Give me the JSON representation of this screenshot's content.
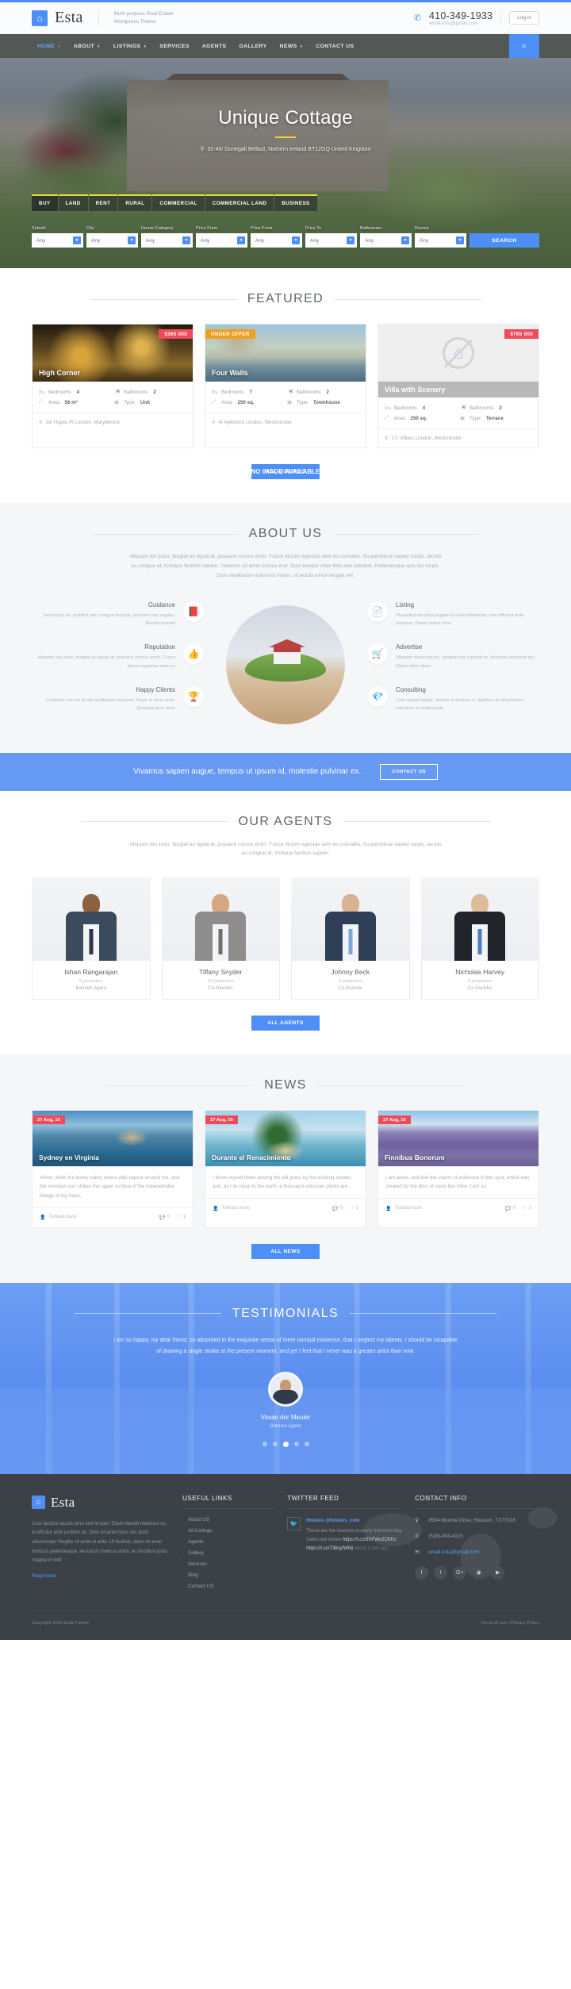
{
  "header": {
    "brand": {
      "name": "Esta",
      "tagline": "Multi-purpose Real Estate Wordpress Theme",
      "icon": "home-icon"
    },
    "phone": "410-349-1933",
    "email": "email.esta@gmail.com",
    "login_label": "Log in"
  },
  "nav": {
    "items": [
      {
        "label": "HOME",
        "has_caret": true,
        "active": true
      },
      {
        "label": "ABOUT",
        "has_caret": true,
        "active": false
      },
      {
        "label": "LISTINGS",
        "has_caret": true,
        "active": false
      },
      {
        "label": "SERVICES",
        "has_caret": false,
        "active": false
      },
      {
        "label": "AGENTS",
        "has_caret": false,
        "active": false
      },
      {
        "label": "GALLERY",
        "has_caret": false,
        "active": false
      },
      {
        "label": "NEWS",
        "has_caret": true,
        "active": false
      },
      {
        "label": "CONTACT US",
        "has_caret": false,
        "active": false
      }
    ],
    "search_icon": "search-icon"
  },
  "hero": {
    "title": "Unique Cottage",
    "address": "32-40/ Donegall Belfast, Nothern Ireland BT12GQ United Kingdom",
    "tabs": [
      "BUY",
      "LAND",
      "RENT",
      "RURAL",
      "COMMERCIAL",
      "COMMERCIAL LAND",
      "BUSINESS"
    ],
    "active_tab": "BUY",
    "fields": [
      {
        "label": "Suburb",
        "value": "Any"
      },
      {
        "label": "City",
        "value": "Any"
      },
      {
        "label": "House Category",
        "value": "Any"
      },
      {
        "label": "Price From",
        "value": "Any"
      },
      {
        "label": "Price From",
        "value": "Any"
      },
      {
        "label": "Price To",
        "value": "Any"
      },
      {
        "label": "Bathrooms",
        "value": "Any"
      },
      {
        "label": "Rooms",
        "value": "Any"
      }
    ],
    "search_label": "SEARCH"
  },
  "featured": {
    "title": "FEATURED",
    "button": "ALL LISTINGS",
    "labels": {
      "bedrooms": "Bedrooms:",
      "bathrooms": "Bathrooms:",
      "area": "Area:",
      "type": "Type:"
    },
    "properties": [
      {
        "name": "High Corner",
        "price": "$365 000",
        "badge": null,
        "bedrooms": "4",
        "bathrooms": "2",
        "area": "56 m²",
        "type": "Unit",
        "address": "18/ Hayes Pl London, Marylebone",
        "no_image": false
      },
      {
        "name": "Four Walls",
        "price": null,
        "badge": "UNDER OFFER",
        "bedrooms": "7",
        "bathrooms": "2",
        "area": "250 sq.",
        "type": "Townhouse",
        "address": "4/ Aylesford London, Westminster",
        "no_image": false
      },
      {
        "name": "Villa with Scenery",
        "price": "$765 000",
        "badge": null,
        "bedrooms": "4",
        "bathrooms": "2",
        "area": "250 sq.",
        "type": "Terrace",
        "address": "17/ Villiers London, Westminster",
        "no_image": true,
        "no_image_label": "NO IMAGE AVAILABLE"
      }
    ]
  },
  "about": {
    "title": "ABOUT US",
    "subtitle": "Aliquam dui justo, feugiat eu ligula at, posuere cursus enim. Fusce dictum egestas sem eu convallis. Suspendisse sapien turpis, iaculis eu congue at, tristique facilisis sapien. Vivamus sit amet cursus erat. Duis tempor vitae felis sed volutpat. Pellentesque quis leo turpis. Duis vestibulum euismod metus, ut iaculis tortor feugiat vel.",
    "left_features": [
      {
        "title": "Guidance",
        "text": "Sed turpis mi, porttitor nec congue tempus, posuere nec sapien. Mauris laoreet",
        "icon": "book-icon"
      },
      {
        "title": "Reputation",
        "text": "Aliquam dui justo, feugiat eu ligula at, posuere cursus enim. Fusce dictum egestas sem eu",
        "icon": "thumbs-up-icon"
      },
      {
        "title": "Happy Clients",
        "text": "Curabitur non mi id elit vestibulum posuere. Nunc in risus eros. Quisque quis risus",
        "icon": "trophy-icon"
      }
    ],
    "right_features": [
      {
        "title": "Listing",
        "text": "Phasellus tincidunt augue id nulla bibendum, non efficitur ante placerat. Donec tortor eros.",
        "icon": "document-icon"
      },
      {
        "title": "Advertise",
        "text": "Aliquam risus mauris, congue sed suscipit in, tincidunt euismod leo. Etiam dolor diam.",
        "icon": "cart-icon"
      },
      {
        "title": "Consulting",
        "text": "Cras neque turpis, dictum at tempus a, dapibus sit amet tortor. Interdum et malesuada",
        "icon": "diamond-icon"
      }
    ]
  },
  "cta": {
    "text": "Vivamus sapien augue, tempus ut ipsum id, molestie pulvinar ex.",
    "button": "CONTACT US"
  },
  "agents": {
    "title": "OUR AGENTS",
    "subtitle": "Aliquam dui justo, feugiat eu ligula at, posuere cursus enim. Fusce dictum egestas sem eu convallis. Suspendisse sapien turpis, iaculis eu congue at, tristique facilisis sapien.",
    "button": "ALL AGENTS",
    "list": [
      {
        "name": "Ishan Rangarajan",
        "properties": "8 properties",
        "role": "Batmen Agent",
        "suit": "#3c4a5e",
        "tie": "#2b3646",
        "skin": "#8a6242"
      },
      {
        "name": "Tiffany Snyder",
        "properties": "10 properties",
        "role": "Co-founder",
        "suit": "#8e8d8b",
        "tie": "#6f6e6c",
        "skin": "#d6a882"
      },
      {
        "name": "Johnny Beck",
        "properties": "6 properties",
        "role": "Co-founder",
        "suit": "#2f3f57",
        "tie": "#7fa8d6",
        "skin": "#d9b391"
      },
      {
        "name": "Nicholas Harvey",
        "properties": "8 properties",
        "role": "Co-founder",
        "suit": "#22242c",
        "tie": "#4f7dc0",
        "skin": "#e0bb97"
      }
    ]
  },
  "news": {
    "title": "NEWS",
    "button": "ALL NEWS",
    "posts": [
      {
        "date": "27 Aug, 15",
        "title": "Sydney en Virginia",
        "excerpt": "When, while the lovely valley teems with vapour around me, and the meridian sun strikes the upper surface of the impenetrable foliage of my trees,",
        "author": "Torbara Isum",
        "comments": "0",
        "likes": "1"
      },
      {
        "date": "27 Aug, 15",
        "title": "Durante el Renacimiento",
        "excerpt": "I throw myself down among the tall grass by the trickling stream; and, as I lie close to the earth, a thousand unknown plants are",
        "author": "Torbara Isum",
        "comments": "0",
        "likes": "1"
      },
      {
        "date": "27 Aug, 15",
        "title": "Finnibus Bonorum",
        "excerpt": "I am alone, and feel the charm of existence in this spot, which was created for the bliss of souls like mine. I am so",
        "author": "Torbara Isum",
        "comments": "0",
        "likes": "1"
      }
    ]
  },
  "testimonials": {
    "title": "TESTIMONIALS",
    "quote": "I am so happy, my dear friend, so absorbed in the exquisite sense of mere tranquil existence, that I neglect my talents. I should be incapable of drawing a single stroke at the present moment; and yet I feel that I never was a greater artist than now.",
    "author": "Vovan der Meuler",
    "role": "Batmen Agent",
    "dots": 5,
    "active_dot": 2
  },
  "footer": {
    "brand": "Esta",
    "about": "Cras facilisis iaculis urna sed tempor. Etiam blandit maximus ex, at efficitur ante porttitor ac. Duis sit amet risus nec justo ullamcorper fringilla sit amet et ante. Ut facilisis, diam sit amet rhoncus pellentesque, leo turpis rhoncus dolor, eu tincidunt justo magna id velit.",
    "read_more": "Read more",
    "useful_links": {
      "title": "USEFUL LINKS",
      "items": [
        "About US",
        "All Listings",
        "Agents",
        "Gallery",
        "Services",
        "Blog",
        "Contact US"
      ]
    },
    "twitter": {
      "title": "TWITTER FEED",
      "user": "Howzes @howzes_com",
      "text": "These are the reasons property investors buy Cebu real estate",
      "link1": "https://t.co/3SFWu2CKKz",
      "link2": "https://t.co/736syfWhij",
      "time": "about 1 min ago"
    },
    "contact": {
      "title": "CONTACT INFO",
      "address": "8594 Monroe Drive, Houston, TX77016",
      "phone": "(518)-883-4015",
      "email": "email.esta@gmail.com"
    },
    "socials": [
      "facebook-icon",
      "twitter-icon",
      "google-plus-icon",
      "dribbble-icon",
      "youtube-icon"
    ],
    "copyright": "Copyright 2015 Esta Theme",
    "bottom_links": "Terms of use | Privacy Policy"
  }
}
